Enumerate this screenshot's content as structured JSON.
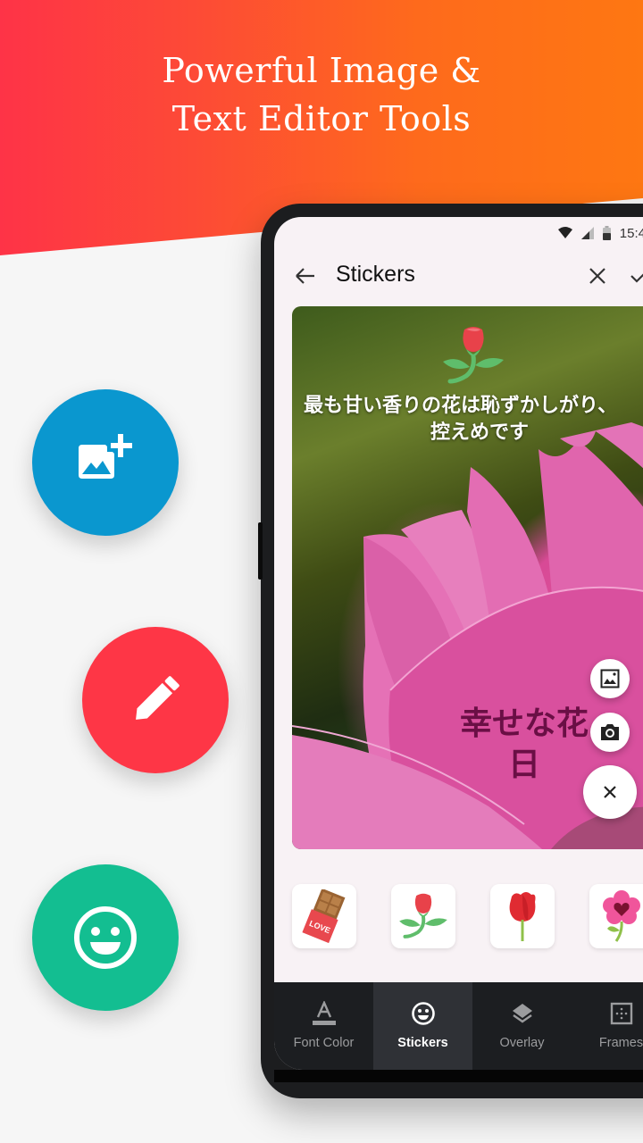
{
  "promo": {
    "headline_line1": "Powerful Image &",
    "headline_line2": "Text Editor Tools",
    "colors": {
      "gradient_start": "#fe3347",
      "gradient_end": "#fe7712",
      "background": "#f6f6f6"
    },
    "features": [
      {
        "icon": "add-photo-icon",
        "color": "#0a97cf"
      },
      {
        "icon": "pencil-icon",
        "color": "#fe3646"
      },
      {
        "icon": "smiley-icon",
        "color": "#13be91"
      }
    ]
  },
  "status_bar": {
    "time": "15:4",
    "icons": [
      "wifi-icon",
      "signal-icon",
      "battery-icon"
    ]
  },
  "toolbar": {
    "title": "Stickers",
    "back_icon": "arrow-left-icon",
    "close_icon": "close-icon",
    "confirm_icon": "check-icon"
  },
  "canvas": {
    "quote_line1": "最も甘い香りの花は恥ずかしがり、",
    "quote_line2": "控えめです",
    "petal_text_line1": "幸せな花",
    "petal_text_line2": "日",
    "top_sticker": "rose-sticker",
    "fab_actions": [
      {
        "icon": "image-icon",
        "label": "gallery"
      },
      {
        "icon": "camera-icon",
        "label": "camera"
      },
      {
        "icon": "close-icon",
        "label": "close"
      }
    ]
  },
  "stickers": [
    {
      "name": "chocolate-love",
      "text": "LOVE"
    },
    {
      "name": "rose-with-leaves"
    },
    {
      "name": "red-rose"
    },
    {
      "name": "heart-flower"
    }
  ],
  "tabs": [
    {
      "label": "Font Color",
      "icon": "font-color-icon",
      "active": false
    },
    {
      "label": "Stickers",
      "icon": "smiley-icon",
      "active": true
    },
    {
      "label": "Overlay",
      "icon": "layers-icon",
      "active": false
    },
    {
      "label": "Frames",
      "icon": "frame-icon",
      "active": false
    }
  ]
}
